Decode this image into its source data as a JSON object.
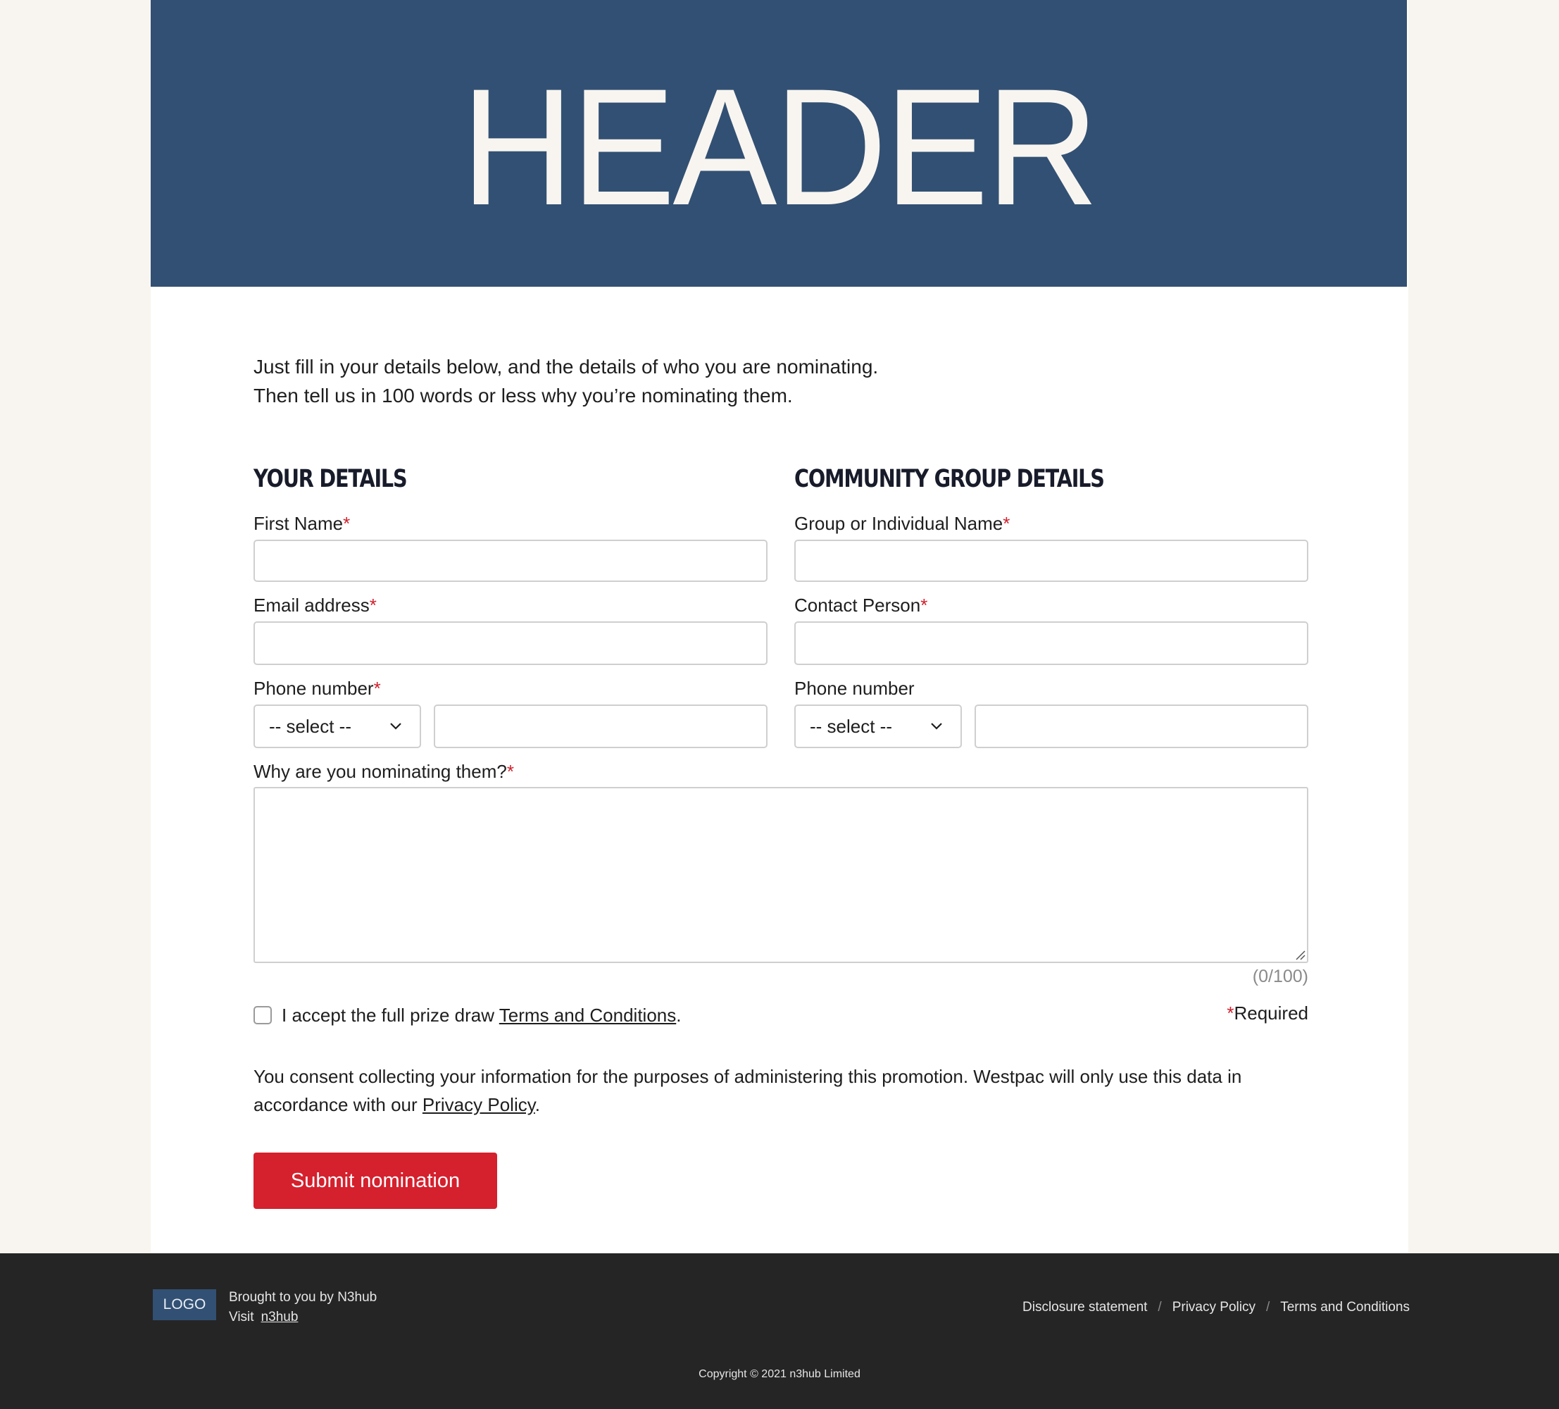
{
  "header": {
    "title": "HEADER"
  },
  "intro": {
    "line1": "Just fill in your details below, and the details of who you are nominating.",
    "line2": "Then tell us in 100 words or less why you’re nominating them."
  },
  "your_details": {
    "heading": "YOUR DETAILS",
    "first_name_label": "First Name",
    "email_label": "Email address",
    "phone_label": "Phone number",
    "phone_select_value": "-- select --"
  },
  "community_details": {
    "heading": "COMMUNITY GROUP DETAILS",
    "group_name_label": "Group or Individual Name",
    "contact_person_label": "Contact Person",
    "phone_label": "Phone number",
    "phone_select_value": "-- select --"
  },
  "nomination": {
    "reason_label": "Why are you nominating them?",
    "counter": "(0/100)"
  },
  "terms": {
    "accept_prefix": "I accept the full prize draw ",
    "accept_link": "Terms and Conditions",
    "accept_suffix": "."
  },
  "required_note": {
    "asterisk": "*",
    "text": "Required"
  },
  "required_marker": "*",
  "consent": {
    "text": "You consent collecting your information for the purposes of administering this promotion. Westpac will only use this data in accordance with our ",
    "link": "Privacy Policy",
    "suffix": "."
  },
  "submit_label": "Submit nomination",
  "footer": {
    "logo": "LOGO",
    "brought_by": "Brought to you by N3hub",
    "visit_label": "Visit",
    "visit_link": "n3hub",
    "links": [
      "Disclosure statement",
      "Privacy Policy",
      "Terms and Conditions"
    ],
    "separator": "/",
    "copyright": "Copyright © 2021 n3hub Limited"
  },
  "colors": {
    "header_bg": "#325073",
    "accent_red": "#d5202d",
    "footer_bg": "#252525",
    "page_bg": "#f8f5f0"
  }
}
